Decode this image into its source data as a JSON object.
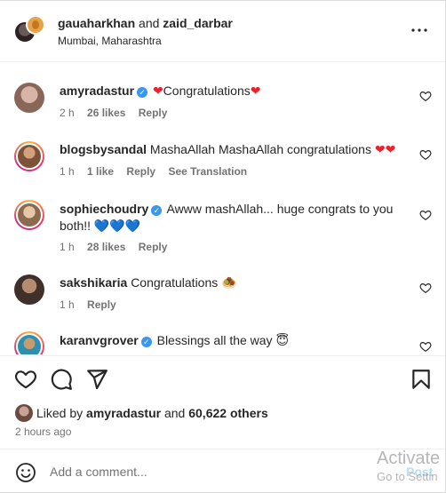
{
  "header": {
    "user1": "gauaharkhan",
    "and_text": "and",
    "user2": "zaid_darbar",
    "location": "Mumbai, Maharashtra",
    "more_icon": "more-horizontal-icon"
  },
  "comments": [
    {
      "username": "amyradastur",
      "verified": true,
      "text": "Congratulations",
      "emoji": "❤",
      "emoji_before": "❤",
      "time": "2 h",
      "likes": "26 likes",
      "reply": "Reply",
      "translation": "",
      "avatar_color": "#c9a296"
    },
    {
      "username": "blogsbysandal",
      "verified": false,
      "text": "MashaAllah MashaAllah congratulations",
      "emoji": "❤❤",
      "time": "1 h",
      "likes": "1 like",
      "reply": "Reply",
      "translation": "See Translation",
      "avatar_color": "#a97a55"
    },
    {
      "username": "sophiechoudry",
      "verified": true,
      "text": "Awww mashAllah... huge congrats to you both!!",
      "emoji": "💙💙💙",
      "time": "1 h",
      "likes": "28 likes",
      "reply": "Reply",
      "translation": "",
      "avatar_color": "#b8906e"
    },
    {
      "username": "sakshikaria",
      "verified": false,
      "text": "Congratulations",
      "emoji": "🧆",
      "time": "1 h",
      "likes": "",
      "reply": "Reply",
      "translation": "",
      "avatar_color": "#5a4a42"
    },
    {
      "username": "karanvgrover",
      "verified": true,
      "text": "Blessings all the way",
      "emoji": "😇",
      "time": "",
      "likes": "",
      "reply": "",
      "translation": "",
      "avatar_color": "#3aa3c2"
    }
  ],
  "actions": {
    "like_icon": "heart-icon",
    "comment_icon": "comment-icon",
    "share_icon": "share-icon",
    "save_icon": "bookmark-icon"
  },
  "likes": {
    "prefix": "Liked by",
    "user": "amyradastur",
    "and": "and",
    "count": "60,622 others"
  },
  "time_ago": "2 hours ago",
  "add_comment": {
    "placeholder": "Add a comment...",
    "post_label": "Post",
    "emoji_icon": "smiley-icon"
  },
  "watermark": {
    "line1": "Activate",
    "line2": "Go to Settin"
  },
  "colors": {
    "verified": "#3897f0",
    "heart": "#ed1f2a",
    "meta": "#737373",
    "post_disabled": "#b2dffc"
  }
}
